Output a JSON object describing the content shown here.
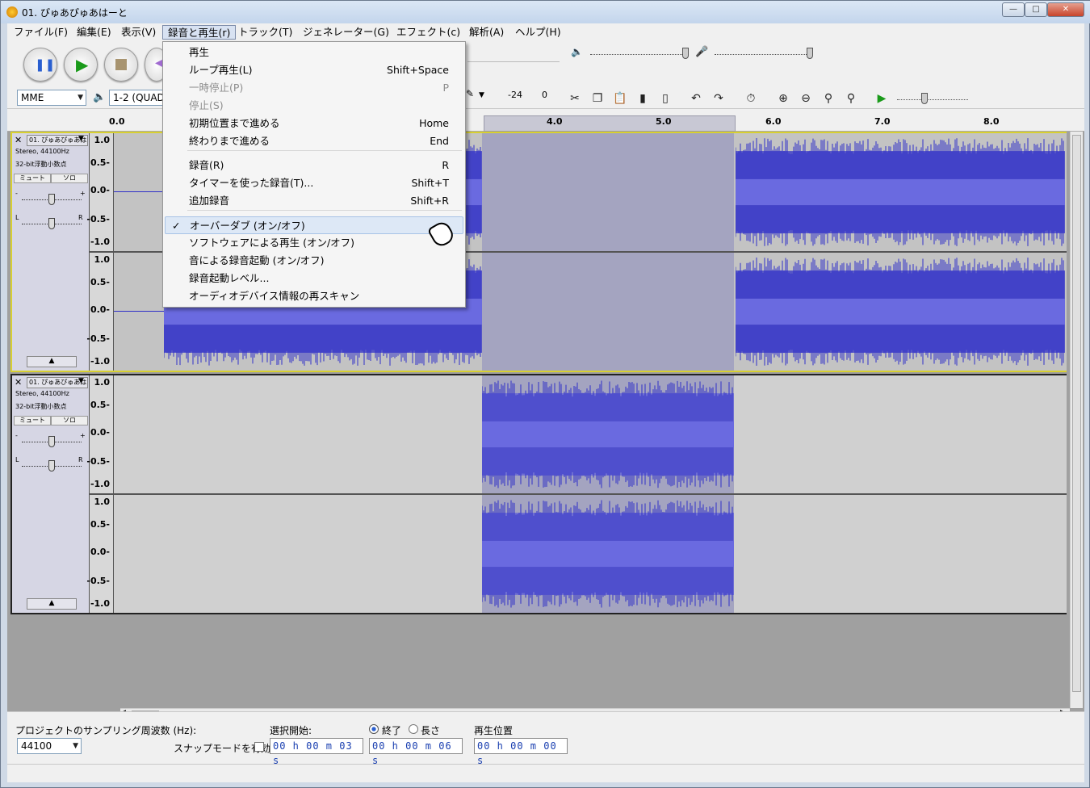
{
  "window": {
    "title": "01. ぴゅあぴゅあはーと"
  },
  "menubar": [
    {
      "label": "ファイル(F)"
    },
    {
      "label": "編集(E)"
    },
    {
      "label": "表示(V)"
    },
    {
      "label": "録音と再生(r)"
    },
    {
      "label": "トラック(T)"
    },
    {
      "label": "ジェネレーター(G)"
    },
    {
      "label": "エフェクト(c)"
    },
    {
      "label": "解析(A)"
    },
    {
      "label": "ヘルプ(H)"
    }
  ],
  "device": {
    "host": "MME",
    "channels": "1-2 (QUAD"
  },
  "meter": {
    "db_label": "-24",
    "db_zero": "0"
  },
  "ruler": {
    "ticks": [
      "0.0",
      "4.0",
      "5.0",
      "6.0",
      "7.0",
      "8.0"
    ]
  },
  "dropdown_menu": {
    "items": [
      {
        "label": "再生",
        "shortcut": ""
      },
      {
        "label": "ループ再生(L)",
        "shortcut": "Shift+Space"
      },
      {
        "label": "一時停止(P)",
        "shortcut": "P"
      },
      {
        "label": "停止(S)",
        "shortcut": ""
      },
      {
        "label": "初期位置まで進める",
        "shortcut": "Home"
      },
      {
        "label": "終わりまで進める",
        "shortcut": "End"
      },
      {
        "label": "録音(R)",
        "shortcut": "R"
      },
      {
        "label": "タイマーを使った録音(T)...",
        "shortcut": "Shift+T"
      },
      {
        "label": "追加録音",
        "shortcut": "Shift+R"
      },
      {
        "label": "オーバーダブ (オン/オフ)",
        "shortcut": "",
        "checked": "✓"
      },
      {
        "label": "ソフトウェアによる再生 (オン/オフ)",
        "shortcut": ""
      },
      {
        "label": "音による録音起動 (オン/オフ)",
        "shortcut": ""
      },
      {
        "label": "録音起動レベル...",
        "shortcut": ""
      },
      {
        "label": "オーディオデバイス情報の再スキャン",
        "shortcut": ""
      }
    ]
  },
  "tracks": [
    {
      "name": "01. ぴゅあぴゅあは",
      "info1": "Stereo, 44100Hz",
      "info2": "32-bit浮動小数点",
      "mute": "ミュート",
      "solo": "ソロ",
      "pan_l": "L",
      "pan_r": "R",
      "gain_minus": "-",
      "gain_plus": "+"
    },
    {
      "name": "01. ぴゅあぴゅあは",
      "info1": "Stereo, 44100Hz",
      "info2": "32-bit浮動小数点",
      "mute": "ミュート",
      "solo": "ソロ",
      "pan_l": "L",
      "pan_r": "R",
      "gain_minus": "-",
      "gain_plus": "+"
    }
  ],
  "scale_labels": [
    "1.0",
    "0.5-",
    "0.0-",
    "-0.5-",
    "-1.0"
  ],
  "status": {
    "rate_label": "プロジェクトのサンプリング周波数 (Hz):",
    "rate_value": "44100",
    "snap_label": "スナップモードを有効",
    "sel_start_label": "選択開始:",
    "end_label": "終了",
    "length_label": "長さ",
    "play_pos_label": "再生位置",
    "sel_start": "00 h 00 m 03 s",
    "sel_end": "00 h 00 m 06 s",
    "play_pos": "00 h 00 m 00 s"
  },
  "colors": {
    "wave": "#3030c8",
    "wave_sel": "#5c5cd8",
    "selection": "#a4a4c0"
  }
}
